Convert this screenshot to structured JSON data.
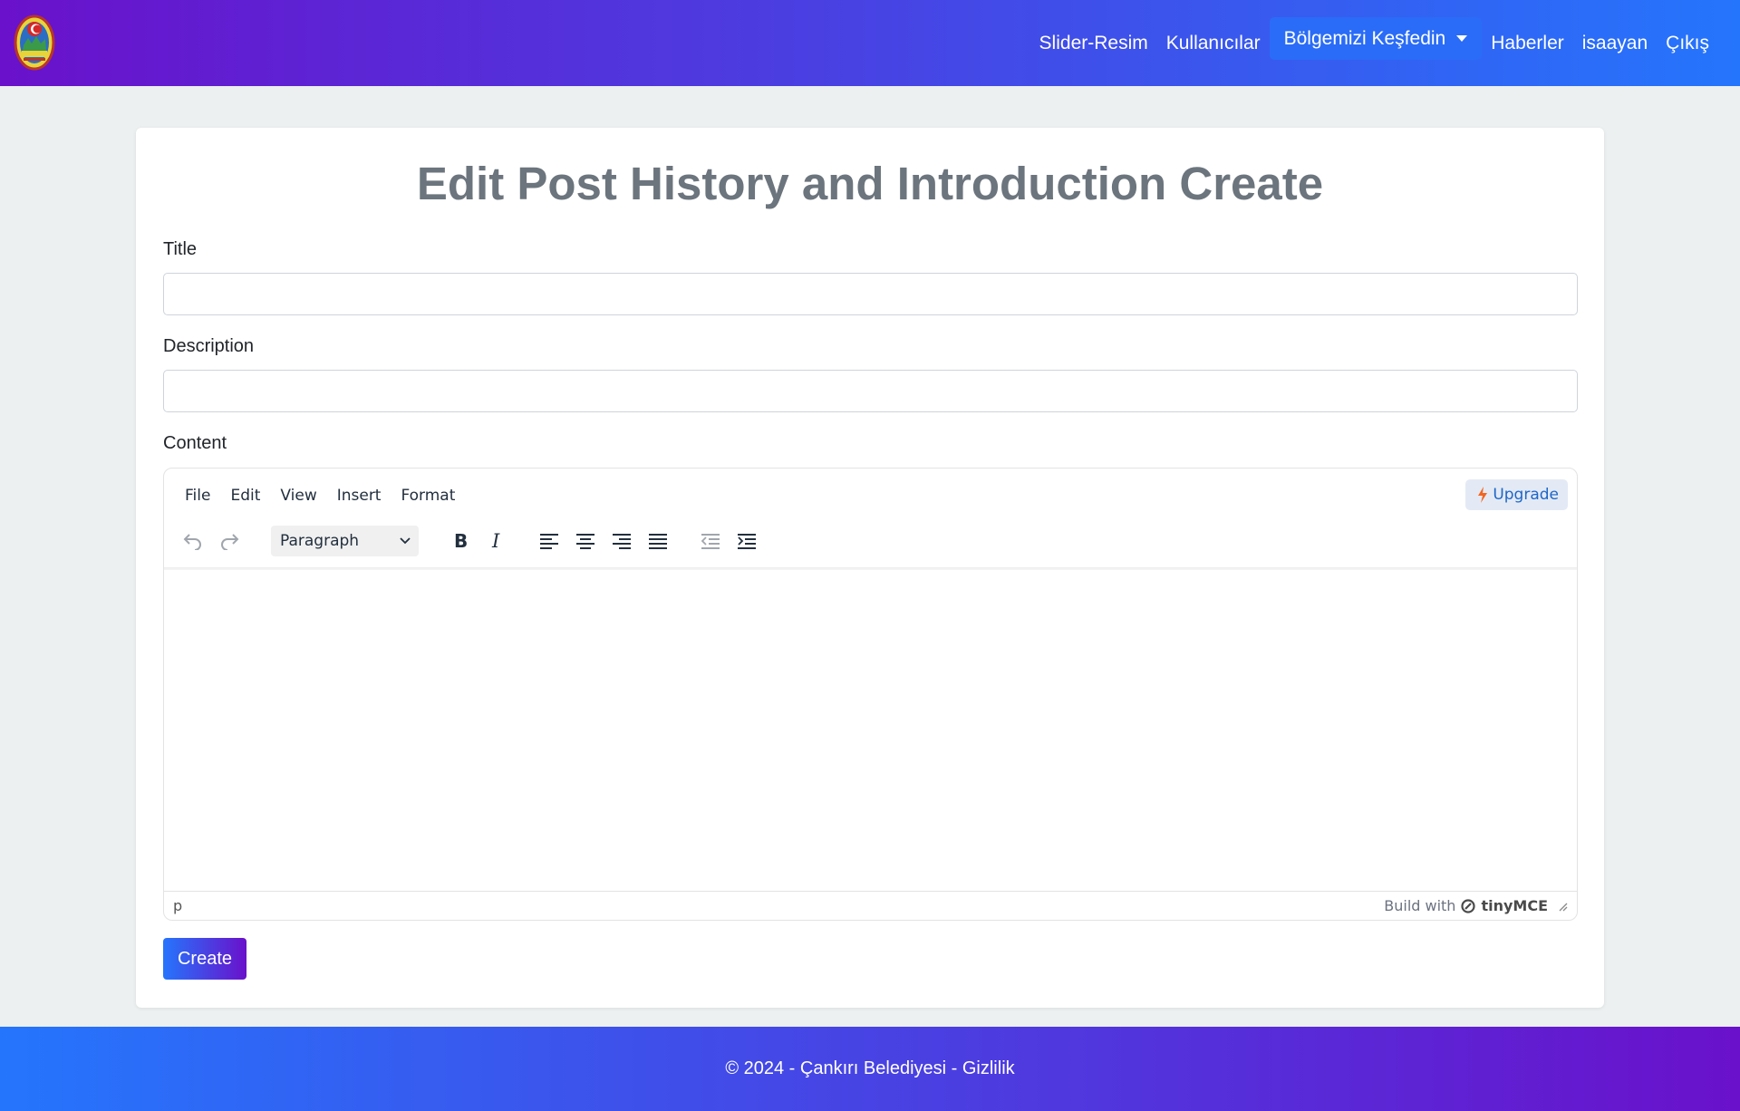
{
  "navbar": {
    "logo_icon": "municipality-crest-icon",
    "links": [
      "Slider-Resim",
      "Kullanıcılar"
    ],
    "dropdown_label": "Bölgemizi Keşfedin",
    "links_right": [
      "Haberler",
      "isaayan",
      "Çıkış"
    ]
  },
  "page": {
    "title": "Edit Post History and Introduction Create"
  },
  "form": {
    "title_label": "Title",
    "title_value": "",
    "description_label": "Description",
    "description_value": "",
    "content_label": "Content",
    "submit_label": "Create"
  },
  "editor": {
    "menu": [
      "File",
      "Edit",
      "View",
      "Insert",
      "Format"
    ],
    "upgrade_label": "Upgrade",
    "block_format": "Paragraph",
    "status_path": "p",
    "branding_prefix": "Build with",
    "branding_name": "tinyMCE"
  },
  "footer": {
    "text": "© 2024 - Çankırı Belediyesi - Gizlilik"
  },
  "colors": {
    "gradient_start": "#6a11cb",
    "gradient_end": "#2575fc",
    "background": "#ecf0f1",
    "title_gray": "#6c757d"
  }
}
